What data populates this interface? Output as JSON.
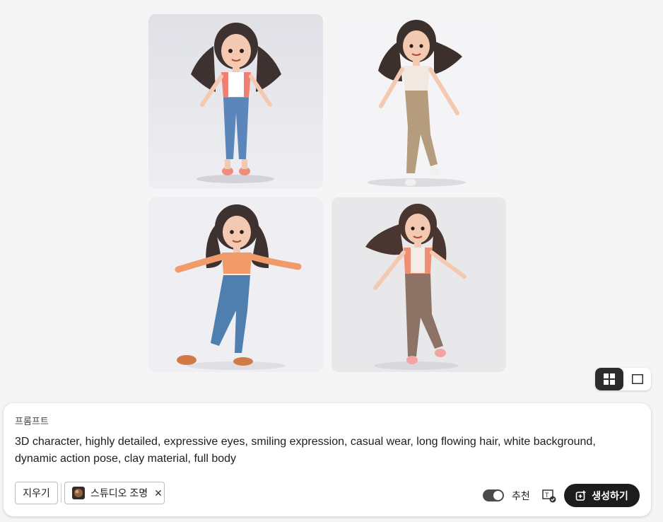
{
  "gallery": {
    "images": [
      {
        "icon": "character-image-1"
      },
      {
        "icon": "character-image-2"
      },
      {
        "icon": "character-image-3"
      },
      {
        "icon": "character-image-4"
      }
    ]
  },
  "view_toggle": {
    "options": [
      {
        "icon": "grid-view-icon",
        "active": true
      },
      {
        "icon": "single-view-icon",
        "active": false
      }
    ]
  },
  "prompt": {
    "label": "프롬프트",
    "text": "3D character, highly detailed, expressive eyes, smiling expression, casual wear, long flowing hair, white background, dynamic action pose, clay material, full body"
  },
  "actions": {
    "clear_label": "지우기",
    "style_chip": {
      "label": "스튜디오 조명",
      "close": "✕",
      "icon": "studio-lighting-thumbnail"
    },
    "recommend_label": "추천",
    "recommend_on": true,
    "prompt_check_icon": "text-check-icon",
    "generate_label": "생성하기",
    "generate_icon": "generate-icon"
  }
}
